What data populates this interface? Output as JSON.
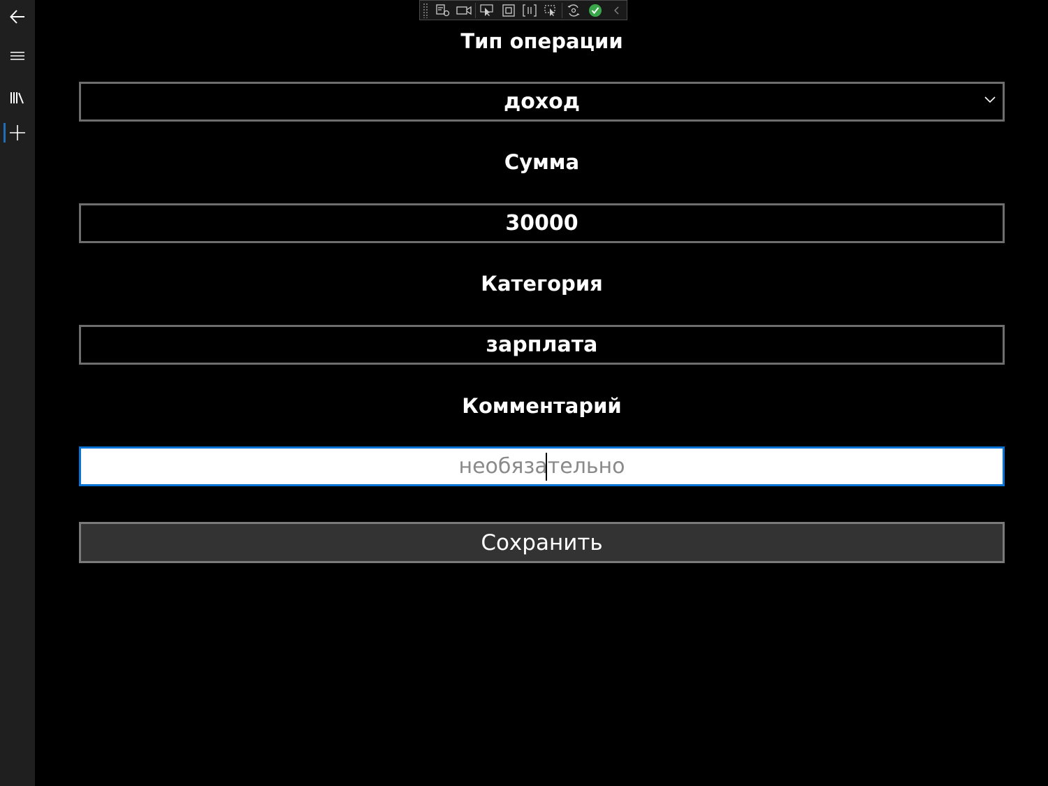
{
  "nav": {
    "items": [
      {
        "icon": "back-arrow-icon"
      },
      {
        "icon": "hamburger-menu-icon"
      },
      {
        "icon": "library-icon"
      },
      {
        "icon": "add-icon",
        "selected": true
      }
    ],
    "accent_color": "#1e6fb8"
  },
  "debug_toolbar": {
    "icons": [
      "live-visual-tree-icon",
      "video-camera-icon",
      "select-element-icon",
      "display-layout-adorners-icon",
      "track-focus-icon",
      "preview-selection-icon",
      "hot-reload-icon",
      "checkmark-icon",
      "collapse-chevron-icon"
    ]
  },
  "form": {
    "operation_type": {
      "label": "Тип операции",
      "selected": "доход"
    },
    "amount": {
      "label": "Сумма",
      "value": "30000"
    },
    "category": {
      "label": "Категория",
      "value": "зарплата"
    },
    "comment": {
      "label": "Комментарий",
      "value": "",
      "placeholder": "необязательно"
    },
    "save_label": "Сохранить"
  },
  "colors": {
    "background": "#000000",
    "nav_background": "#1f1f1f",
    "field_border": "#6e6e6e",
    "focus_border": "#0a73d6",
    "button_background": "#333333"
  }
}
